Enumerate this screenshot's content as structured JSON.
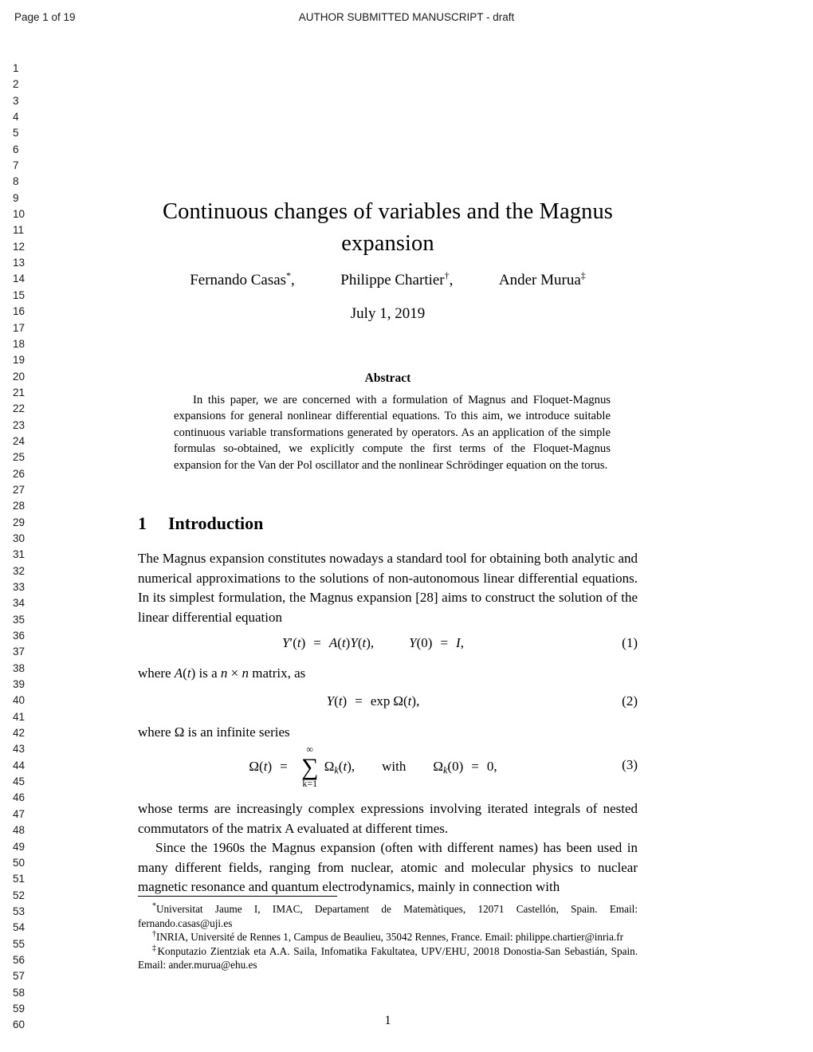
{
  "header": {
    "left": "Page 1 of 19",
    "center": "AUTHOR SUBMITTED MANUSCRIPT - draft"
  },
  "line_numbers": [
    "1",
    "2",
    "3",
    "4",
    "5",
    "6",
    "7",
    "8",
    "9",
    "10",
    "11",
    "12",
    "13",
    "14",
    "15",
    "16",
    "17",
    "18",
    "19",
    "20",
    "21",
    "22",
    "23",
    "24",
    "25",
    "26",
    "27",
    "28",
    "29",
    "30",
    "31",
    "32",
    "33",
    "34",
    "35",
    "36",
    "37",
    "38",
    "39",
    "40",
    "41",
    "42",
    "43",
    "44",
    "45",
    "46",
    "47",
    "48",
    "49",
    "50",
    "51",
    "52",
    "53",
    "54",
    "55",
    "56",
    "57",
    "58",
    "59",
    "60"
  ],
  "title": {
    "line1": "Continuous changes of variables and the Magnus",
    "line2": "expansion"
  },
  "authors": [
    {
      "name": "Fernando Casas",
      "marker": "*",
      "trailing": ","
    },
    {
      "name": "Philippe Chartier",
      "marker": "†",
      "trailing": ","
    },
    {
      "name": "Ander Murua",
      "marker": "‡",
      "trailing": ""
    }
  ],
  "date": "July 1, 2019",
  "abstract": {
    "heading": "Abstract",
    "text": "In this paper, we are concerned with a formulation of Magnus and Floquet-Magnus expansions for general nonlinear differential equations. To this aim, we introduce suitable continuous variable transformations generated by operators. As an application of the simple formulas so-obtained, we explicitly compute the first terms of the Floquet-Magnus expansion for the Van der Pol oscillator and the nonlinear Schrödinger equation on the torus."
  },
  "section": {
    "number": "1",
    "title": "Introduction"
  },
  "paragraphs": {
    "intro": "The Magnus expansion constitutes nowadays a standard tool for obtaining both analytic and numerical approximations to the solutions of non-autonomous linear differential equations. In its simplest formulation, the Magnus expansion [28] aims to construct the solution of the linear differential equation",
    "where_A_pre": "where ",
    "where_A_mid": " is a ",
    "where_A_post": " matrix, as",
    "where_omega_pre": "where ",
    "where_omega_post": " is an infinite series",
    "whose": "whose terms are increasingly complex expressions involving iterated integrals of nested commutators of the matrix A evaluated at different times.",
    "since": "Since the 1960s the Magnus expansion (often with different names) has been used in many different fields, ranging from nuclear, atomic and molecular physics to nuclear magnetic resonance and quantum electrodynamics, mainly in connection with"
  },
  "equations": {
    "eq1": {
      "latex": "Y'(t) = A(t)Y(t),\\qquad Y(0) = I,",
      "number": "(1)"
    },
    "eq2": {
      "latex": "Y(t) = \\exp \\Omega(t),",
      "number": "(2)"
    },
    "eq3": {
      "latex": "\\Omega(t) = \\sum_{k=1}^{\\infty} \\Omega_k(t), \\qquad \\text{with} \\qquad \\Omega_k(0) = 0,",
      "number": "(3)",
      "sum_upper": "∞",
      "sum_lower": "k=1",
      "with_word": "with"
    }
  },
  "footnotes": [
    {
      "marker": "*",
      "text": "Universitat Jaume I, IMAC, Departament de Matemàtiques, 12071 Castellón, Spain. Email: fernando.casas@uji.es"
    },
    {
      "marker": "†",
      "text": "INRIA, Université de Rennes 1, Campus de Beaulieu, 35042 Rennes, France. Email: philippe.chartier@inria.fr"
    },
    {
      "marker": "‡",
      "text": "Konputazio Zientziak eta A.A. Saila, Infomatika Fakultatea, UPV/EHU, 20018 Donostia-San Sebastián, Spain. Email: ander.murua@ehu.es"
    }
  ],
  "folio": "1"
}
